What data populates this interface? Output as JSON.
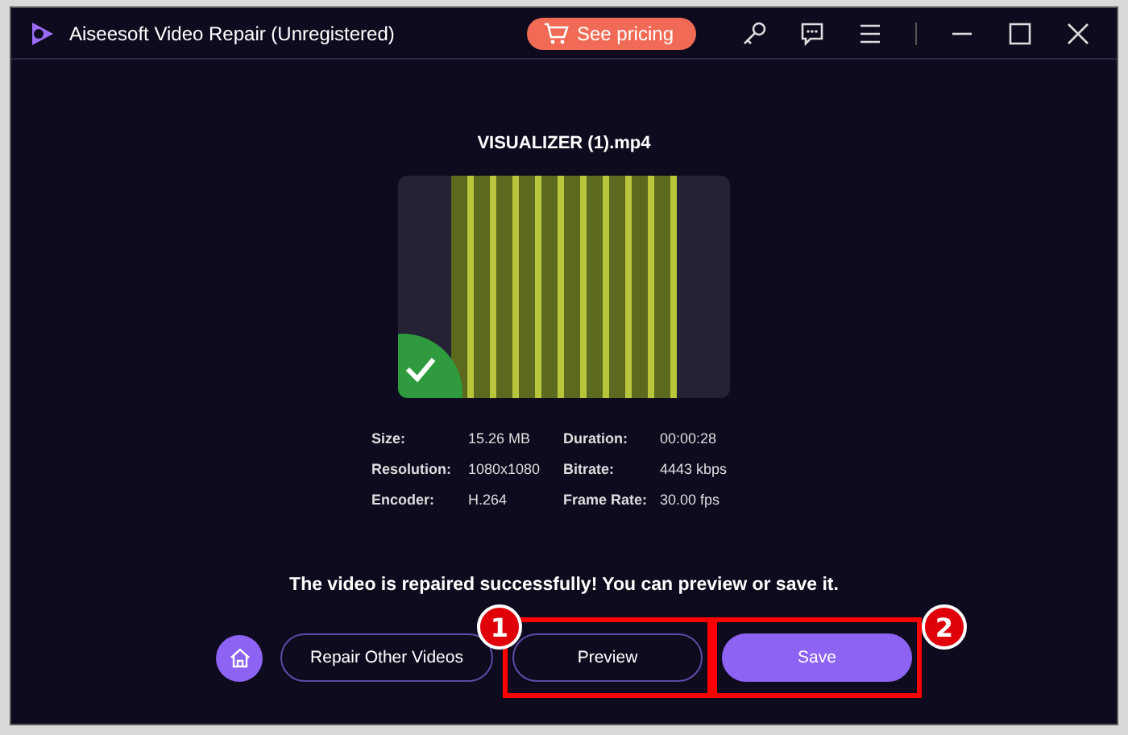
{
  "window": {
    "title": "Aiseesoft Video Repair (Unregistered)",
    "pricing_button": "See pricing"
  },
  "file": {
    "name": "VISUALIZER (1).mp4",
    "repaired": true
  },
  "info": [
    [
      {
        "label": "Size:",
        "value": "15.26 MB"
      },
      {
        "label": "Duration:",
        "value": "00:00:28"
      }
    ],
    [
      {
        "label": "Resolution:",
        "value": "1080x1080"
      },
      {
        "label": "Bitrate:",
        "value": "4443 kbps"
      }
    ],
    [
      {
        "label": "Encoder:",
        "value": "H.264"
      },
      {
        "label": "Frame Rate:",
        "value": "30.00 fps"
      }
    ]
  ],
  "message": "The video is repaired successfully! You can preview or save it.",
  "buttons": [
    {
      "kind": "home"
    },
    {
      "kind": "outline",
      "label": "Repair Other Videos"
    },
    {
      "kind": "outline",
      "label": "Preview",
      "callout": "1"
    },
    {
      "kind": "primary",
      "label": "Save",
      "callout": "2"
    }
  ]
}
